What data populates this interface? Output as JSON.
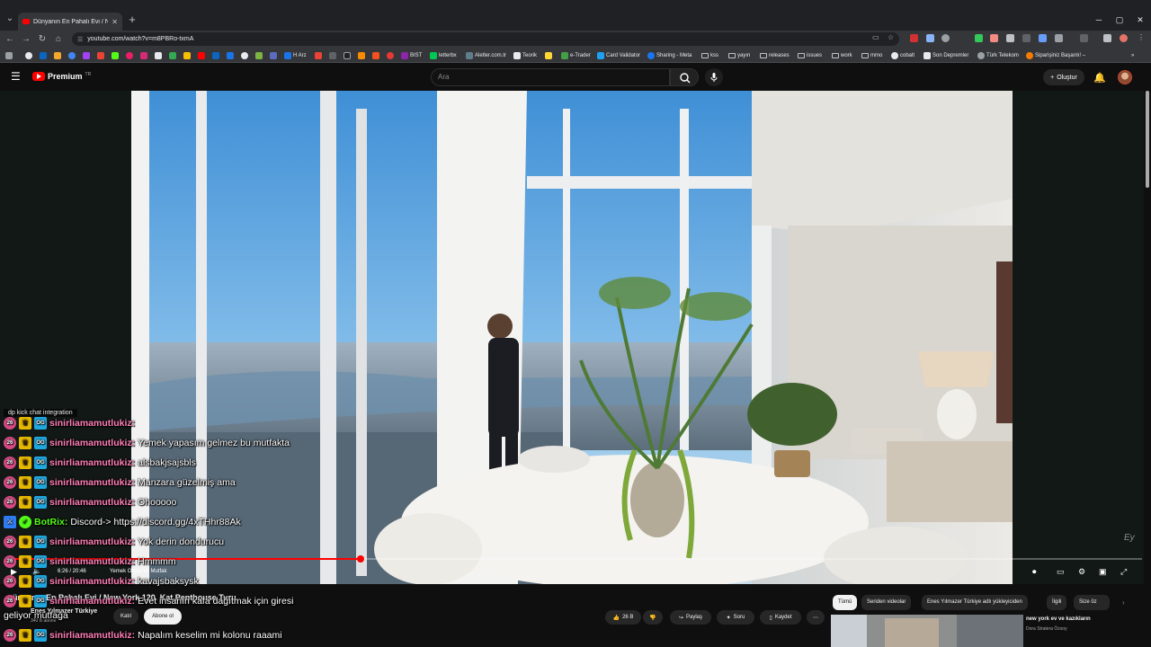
{
  "browser": {
    "tab_title": "Dünyanın En Pahalı Evi / New Y",
    "url": "youtube.com/watch?v=m8PBRo-txmA",
    "bookmarks": [
      "H Arz",
      "BIST",
      "letterbx",
      "Aletler.com.tr",
      "Teorik",
      "e-Trader",
      "Card Validator",
      "Sharing - Meta",
      "kss",
      "yayın",
      "releases",
      "issues",
      "work",
      "mmo",
      "cobalt",
      "Son Depremler",
      "Türk Telekom",
      "Siparişiniz Başarılı! –"
    ]
  },
  "masthead": {
    "logo": "Premium",
    "logo_region": "TR",
    "search_placeholder": "Ara",
    "create_label": "Oluştur"
  },
  "player": {
    "time": "6:26 / 20:46",
    "chapter": "Yemek Odası ve Mutfak",
    "progress": 0.31,
    "watermark": "Ey"
  },
  "video": {
    "title_partial": "ünyanın En Pahalı Evi / New York 120. Kat Penthouse Turu",
    "channel": "Enes Yılmazer Türkiye",
    "subscribers": "340 B abone",
    "join_label": "Katıl",
    "subscribe_label": "Abone ol",
    "likes": "26 B",
    "share_label": "Paylaş",
    "ask_label": "Soru",
    "save_label": "Kaydet"
  },
  "recommend": {
    "chips": [
      "Tümü",
      "Seriden videolar",
      "Enes Yılmazer Türkiye adlı yükleyiciden",
      "İlgili",
      "Size öz"
    ],
    "first_title": "new york ev ve kazıkların",
    "first_channel": "Dora Stratera Özsoy"
  },
  "chat": {
    "header": "dp kick chat integration",
    "messages": [
      {
        "user": "sinirliamamutlukiz:",
        "text": "",
        "type": "sub",
        "badge": "26"
      },
      {
        "user": "sinirliamamutlukiz:",
        "text": "Yemek yapasım gelmez bu mutfakta",
        "type": "sub",
        "badge": "26"
      },
      {
        "user": "sinirliamamutlukiz:",
        "text": "alsbakjsajsbls",
        "type": "sub",
        "badge": "26"
      },
      {
        "user": "sinirliamamutlukiz:",
        "text": "Manzara güzelmiş ama",
        "type": "sub",
        "badge": "26"
      },
      {
        "user": "sinirliamamutlukiz:",
        "text": "Ohooooo",
        "type": "sub",
        "badge": "26"
      },
      {
        "user": "BotRix:",
        "text": "Discord-> https://discord.gg/4xTHhr88Ak",
        "type": "bot",
        "badge": ""
      },
      {
        "user": "sinirliamamutlukiz:",
        "text": "Yok derin dondurucu",
        "type": "sub",
        "badge": "26"
      },
      {
        "user": "sinirliamamutlukiz:",
        "text": "Hmmmm",
        "type": "sub",
        "badge": "26"
      },
      {
        "user": "sinirliamamutlukiz:",
        "text": "kavajsbaksysk",
        "type": "sub",
        "badge": "26"
      },
      {
        "user": "sinirliamamutlukiz:",
        "text": "Evet insanın kafa dağıtmak için giresi",
        "type": "sub",
        "badge": "26"
      },
      {
        "user": "",
        "text": "geliyor mutfağa",
        "type": "cont",
        "badge": ""
      },
      {
        "user": "sinirliamamutlukiz:",
        "text": "Napalım keselim mi kolonu raaami",
        "type": "sub",
        "badge": "26"
      }
    ]
  },
  "colors": {
    "accent": "#ff0000",
    "chat_user": "#ff7eb6",
    "bot_user": "#53fc18"
  }
}
